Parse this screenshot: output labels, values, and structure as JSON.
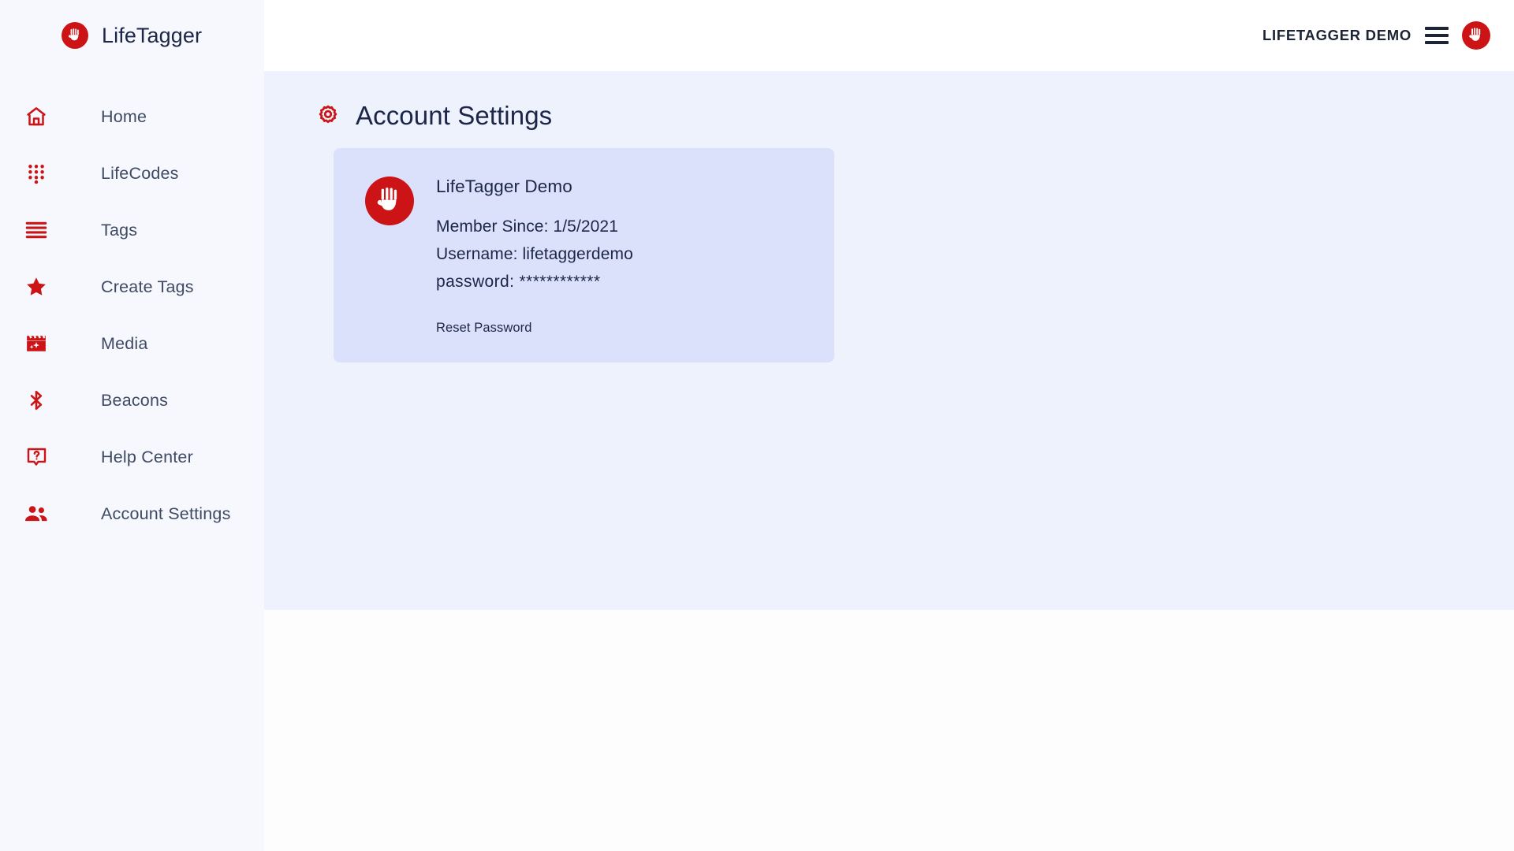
{
  "brand": {
    "name": "LifeTagger",
    "logo_icon": "hand-logo-icon",
    "accent_color": "#cc1417"
  },
  "sidebar": {
    "background_color": "#f6f8fd",
    "items": [
      {
        "label": "Home",
        "icon": "home-icon"
      },
      {
        "label": "LifeCodes",
        "icon": "dialpad-icon"
      },
      {
        "label": "Tags",
        "icon": "menu-lines-icon"
      },
      {
        "label": "Create Tags",
        "icon": "star-icon"
      },
      {
        "label": "Media",
        "icon": "movie-clapper-icon"
      },
      {
        "label": "Beacons",
        "icon": "bluetooth-icon"
      },
      {
        "label": "Help Center",
        "icon": "help-bubble-icon"
      },
      {
        "label": "Account Settings",
        "icon": "people-group-icon"
      }
    ]
  },
  "topbar": {
    "user_label": "LIFETAGGER DEMO",
    "menu_icon": "hamburger-menu-icon",
    "avatar_icon": "hand-avatar-icon"
  },
  "page": {
    "title": "Account Settings",
    "title_icon": "gear-icon",
    "background_color": "#eef2fd"
  },
  "profile_card": {
    "background_color": "#dbe1fb",
    "avatar_icon": "hand-avatar-icon",
    "display_name": "LifeTagger Demo",
    "member_since": "Member Since: 1/5/2021",
    "username": "Username: lifetaggerdemo",
    "password": "password: ************",
    "reset_password_label": "Reset Password"
  }
}
